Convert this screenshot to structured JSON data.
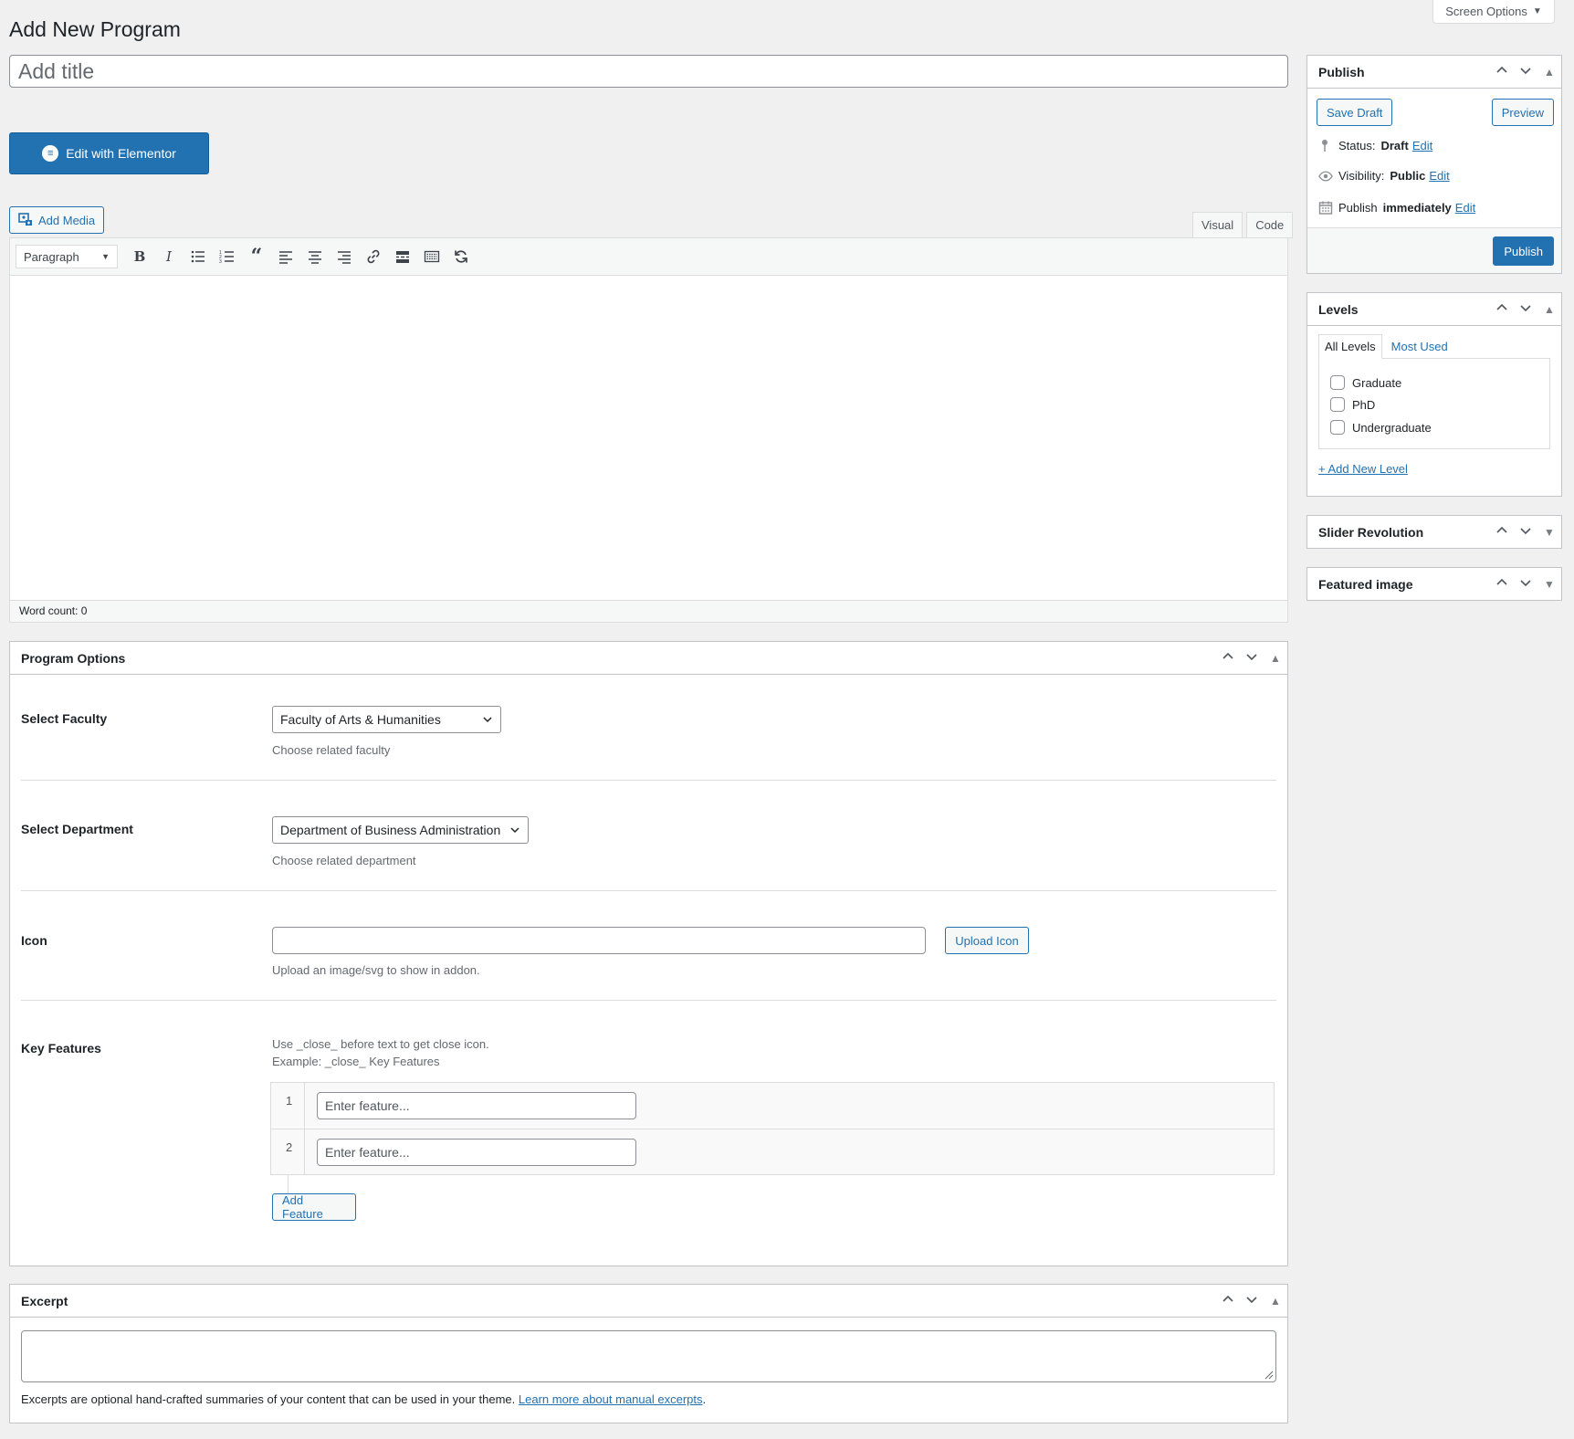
{
  "screen_options": {
    "label": "Screen Options"
  },
  "page": {
    "title": "Add New Program"
  },
  "title_field": {
    "placeholder": "Add title",
    "value": ""
  },
  "elementor": {
    "label": "Edit with Elementor"
  },
  "media": {
    "label": "Add Media"
  },
  "editor": {
    "tabs": [
      "Visual",
      "Code"
    ],
    "format": "Paragraph",
    "word_count": "Word count: 0",
    "toolbar_icons": [
      "bold-icon",
      "italic-icon",
      "bullet-list-icon",
      "numbered-list-icon",
      "blockquote-icon",
      "align-left-icon",
      "align-center-icon",
      "align-right-icon",
      "link-icon",
      "read-more-icon",
      "toolbar-toggle-icon",
      "refresh-icon"
    ]
  },
  "program_options": {
    "title": "Program Options",
    "faculty": {
      "label": "Select Faculty",
      "value": "Faculty of Arts & Humanities",
      "desc": "Choose related faculty"
    },
    "department": {
      "label": "Select Department",
      "value": "Department of Business Administration",
      "desc": "Choose related department"
    },
    "icon": {
      "label": "Icon",
      "value": "",
      "button": "Upload Icon",
      "desc": "Upload an image/svg to show in addon."
    },
    "features": {
      "label": "Key Features",
      "help_1": "Use _close_ before text to get close icon.",
      "help_2": "Example: _close_ Key Features",
      "rows": [
        {
          "num": "1",
          "placeholder": "Enter feature..."
        },
        {
          "num": "2",
          "placeholder": "Enter feature..."
        }
      ],
      "add_button": "Add Feature"
    }
  },
  "excerpt": {
    "title": "Excerpt",
    "value": "",
    "help": "Excerpts are optional hand-crafted summaries of your content that can be used in your theme.",
    "link": "Learn more about manual excerpts",
    "period": "."
  },
  "publish": {
    "title": "Publish",
    "save_draft": "Save Draft",
    "preview": "Preview",
    "status_label": "Status:",
    "status_value": "Draft",
    "visibility_label": "Visibility:",
    "visibility_value": "Public",
    "publish_label": "Publish",
    "publish_value": "immediately",
    "edit": "Edit",
    "publish_button": "Publish"
  },
  "levels": {
    "title": "Levels",
    "tabs": [
      "All Levels",
      "Most Used"
    ],
    "items": [
      "Graduate",
      "PhD",
      "Undergraduate"
    ],
    "add_link": "+ Add New Level"
  },
  "slider_revolution": {
    "title": "Slider Revolution"
  },
  "featured_image": {
    "title": "Featured image"
  },
  "colors": {
    "primary": "#2271b1",
    "background": "#f0f0f1",
    "border": "#c3c4c7"
  }
}
